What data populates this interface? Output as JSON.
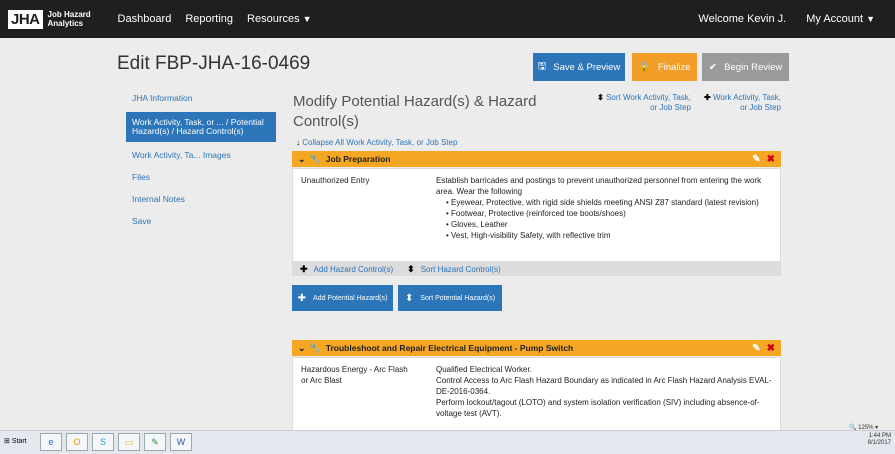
{
  "topnav": {
    "logo_mark": "JHA",
    "logo_text": "Job Hazard Analytics",
    "items": [
      "Dashboard",
      "Reporting",
      "Resources"
    ],
    "welcome": "Welcome Kevin J.",
    "account": "My Account"
  },
  "page": {
    "title": "Edit FBP-JHA-16-0469",
    "save_label": "Save & Preview",
    "finalize_label": "Finalize",
    "review_label": "Begin Review"
  },
  "sidebar": {
    "items": [
      "JHA Information",
      "Work Activity, Task, or ... / Potential Hazard(s) / Hazard Control(s)",
      "Work Activity, Ta... Images",
      "Files",
      "Internal Notes",
      "Save"
    ]
  },
  "main": {
    "title": "Modify Potential Hazard(s) & Hazard Control(s)",
    "sort_work": "Sort Work Activity, Task, or Job Step",
    "add_work": "Work Activity, Task, or Job Step",
    "collapse": "Collapse All Work Activity, Task, or Job Step"
  },
  "panel1": {
    "title": "Job Preparation",
    "hazard": "Unauthorized Entry",
    "control_intro": "Establish barricades and postings to prevent unauthorized personnel from entering the work area. Wear the following",
    "bullets": [
      "Eyewear, Protective, with rigid side shields meeting ANSI Z87 standard (latest revision)",
      "Footwear, Protective (reinforced toe boots/shoes)",
      "Gloves, Leather",
      "Vest, High-visibility Safety, with reflective trim"
    ],
    "add_control": "Add Hazard Control(s)",
    "sort_control": "Sort Hazard Control(s)"
  },
  "buttons": {
    "add_potential": "Add Potential Hazard(s)",
    "sort_potential": "Sort Potential Hazard(s)"
  },
  "panel2": {
    "title": "Troubleshoot and Repair Electrical Equipment - Pump Switch",
    "hazard": "Hazardous Energy - Arc Flash or Arc Blast",
    "controls": [
      "Qualified Electrical Worker.",
      "Control Access to Arc Flash Hazard Boundary as indicated in Arc Flash Hazard Analysis EVAL-DE-2016-0364.",
      "Perform lockout/tagout (LOTO) and system isolation verification (SIV) including absence-of-voltage test (AVT)."
    ]
  },
  "taskbar": {
    "start": "Start",
    "time": "1:44 PM",
    "date": "8/1/2017",
    "zoom": "125%"
  }
}
